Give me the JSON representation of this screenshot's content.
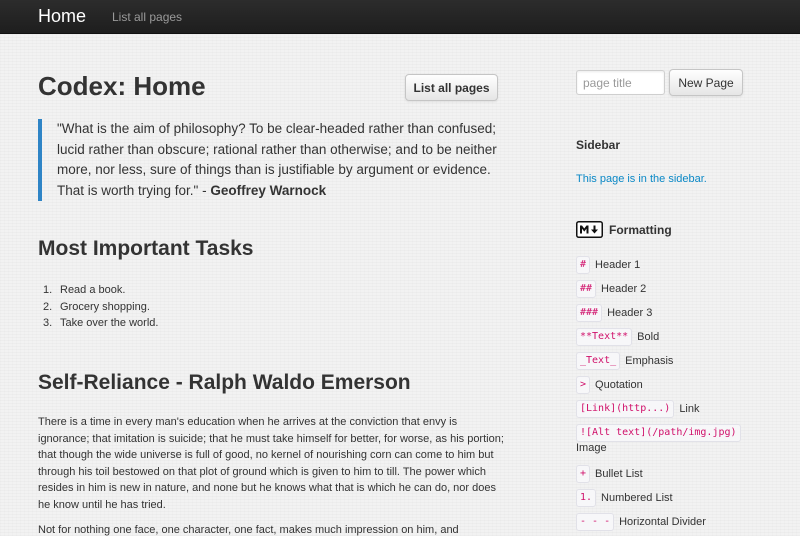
{
  "navbar": {
    "brand": "Home",
    "link": "List all pages"
  },
  "main": {
    "title": "Codex: Home",
    "list_button": "List all pages",
    "quote": {
      "text": "\"What is the aim of philosophy? To be clear-headed rather than confused; lucid rather than obscure; rational rather than otherwise; and to be neither more, nor less, sure of things than is justifiable by argument or evidence. That is worth trying for.\" - ",
      "author": "Geoffrey Warnock"
    },
    "tasks_title": "Most Important Tasks",
    "tasks": [
      {
        "num": "1.",
        "text": "Read a book."
      },
      {
        "num": "2.",
        "text": "Grocery shopping."
      },
      {
        "num": "3.",
        "text": "Take over the world."
      }
    ],
    "emerson_title": "Self-Reliance - Ralph Waldo Emerson",
    "para1": "There is a time in every man's education when he arrives at the conviction that envy is ignorance; that imitation is suicide; that he must take himself for better, for worse, as his portion; that though the wide universe is full of good, no kernel of nourishing corn can come to him but through his toil bestowed on that plot of ground which is given to him to till. The power which resides in him is new in nature, and none but he knows what that is which he can do, nor does he know until he has tried.",
    "para2": "Not for nothing one face, one character, one fact, makes much impression on him, and"
  },
  "sidebar": {
    "title_placeholder": "page title",
    "new_page_button": "New Page",
    "sidebar_title": "Sidebar",
    "sidebar_text": "This page is in the sidebar.",
    "formatting_title": "Formatting",
    "formatting_icon": "markdown-icon",
    "formatting": [
      {
        "code": "#",
        "label": "Header 1"
      },
      {
        "code": "##",
        "label": "Header 2"
      },
      {
        "code": "###",
        "label": "Header 3"
      },
      {
        "code": "**Text**",
        "label": "Bold"
      },
      {
        "code": "_Text_",
        "label": "Emphasis"
      },
      {
        "code": ">",
        "label": "Quotation"
      },
      {
        "code": "[Link](http...)",
        "label": "Link"
      },
      {
        "code": "![Alt text](/path/img.jpg)",
        "label": "Image"
      },
      {
        "code": "+",
        "label": "Bullet List"
      },
      {
        "code": "1.",
        "label": "Numbered List"
      },
      {
        "code": "- - -",
        "label": "Horizontal Divider"
      }
    ]
  },
  "colors": {
    "navbar": "#222222",
    "link": "#0a88c6",
    "quote_border": "#2e84c6",
    "code": "#d0106a"
  }
}
